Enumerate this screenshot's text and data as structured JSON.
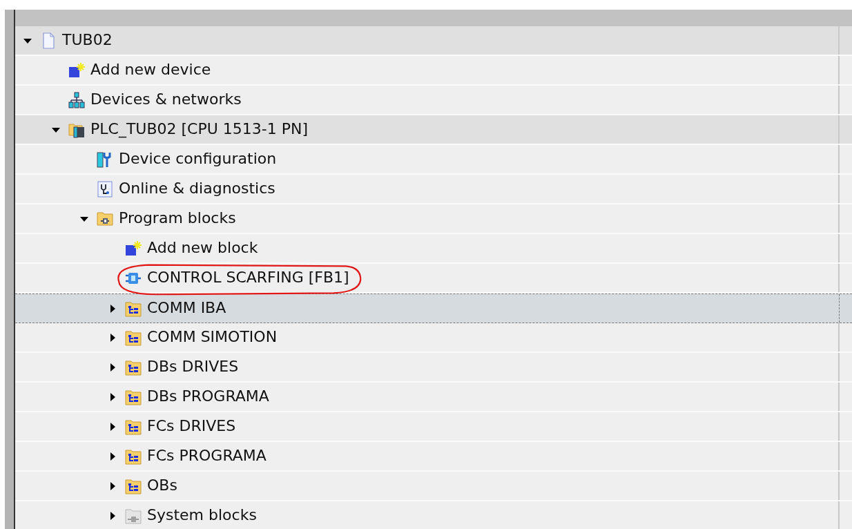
{
  "tree": [
    {
      "label": "TUB02",
      "kind": "project",
      "expanded": true,
      "shaded": true,
      "selected": false,
      "circled": false,
      "children": [
        {
          "label": "Add new device",
          "kind": "add-device",
          "shaded": false,
          "selected": false,
          "circled": false
        },
        {
          "label": "Devices & networks",
          "kind": "network",
          "shaded": false,
          "selected": false,
          "circled": false
        },
        {
          "label": "PLC_TUB02 [CPU 1513-1 PN]",
          "kind": "plc",
          "expanded": true,
          "shaded": true,
          "selected": false,
          "circled": false,
          "children": [
            {
              "label": "Device configuration",
              "kind": "device-config",
              "shaded": false,
              "selected": false,
              "circled": false
            },
            {
              "label": "Online & diagnostics",
              "kind": "diagnostics",
              "shaded": false,
              "selected": false,
              "circled": false
            },
            {
              "label": "Program blocks",
              "kind": "program-folder",
              "expanded": true,
              "shaded": false,
              "selected": false,
              "circled": false,
              "children": [
                {
                  "label": "Add new block",
                  "kind": "add-block",
                  "shaded": false,
                  "selected": false,
                  "circled": false
                },
                {
                  "label": "CONTROL SCARFING [FB1]",
                  "kind": "function-block",
                  "shaded": false,
                  "selected": false,
                  "circled": true
                },
                {
                  "label": "COMM IBA",
                  "kind": "group-folder",
                  "expanded": false,
                  "shaded": false,
                  "selected": true,
                  "circled": false
                },
                {
                  "label": "COMM SIMOTION",
                  "kind": "group-folder",
                  "expanded": false,
                  "shaded": false,
                  "selected": false,
                  "circled": false
                },
                {
                  "label": "DBs DRIVES",
                  "kind": "group-folder",
                  "expanded": false,
                  "shaded": false,
                  "selected": false,
                  "circled": false
                },
                {
                  "label": "DBs PROGRAMA",
                  "kind": "group-folder",
                  "expanded": false,
                  "shaded": false,
                  "selected": false,
                  "circled": false
                },
                {
                  "label": "FCs DRIVES",
                  "kind": "group-folder",
                  "expanded": false,
                  "shaded": false,
                  "selected": false,
                  "circled": false
                },
                {
                  "label": "FCs PROGRAMA",
                  "kind": "group-folder",
                  "expanded": false,
                  "shaded": false,
                  "selected": false,
                  "circled": false
                },
                {
                  "label": "OBs",
                  "kind": "group-folder",
                  "expanded": false,
                  "shaded": false,
                  "selected": false,
                  "circled": false
                },
                {
                  "label": "System blocks",
                  "kind": "system-folder",
                  "expanded": false,
                  "shaded": false,
                  "selected": false,
                  "circled": false
                }
              ]
            }
          ]
        }
      ]
    }
  ]
}
